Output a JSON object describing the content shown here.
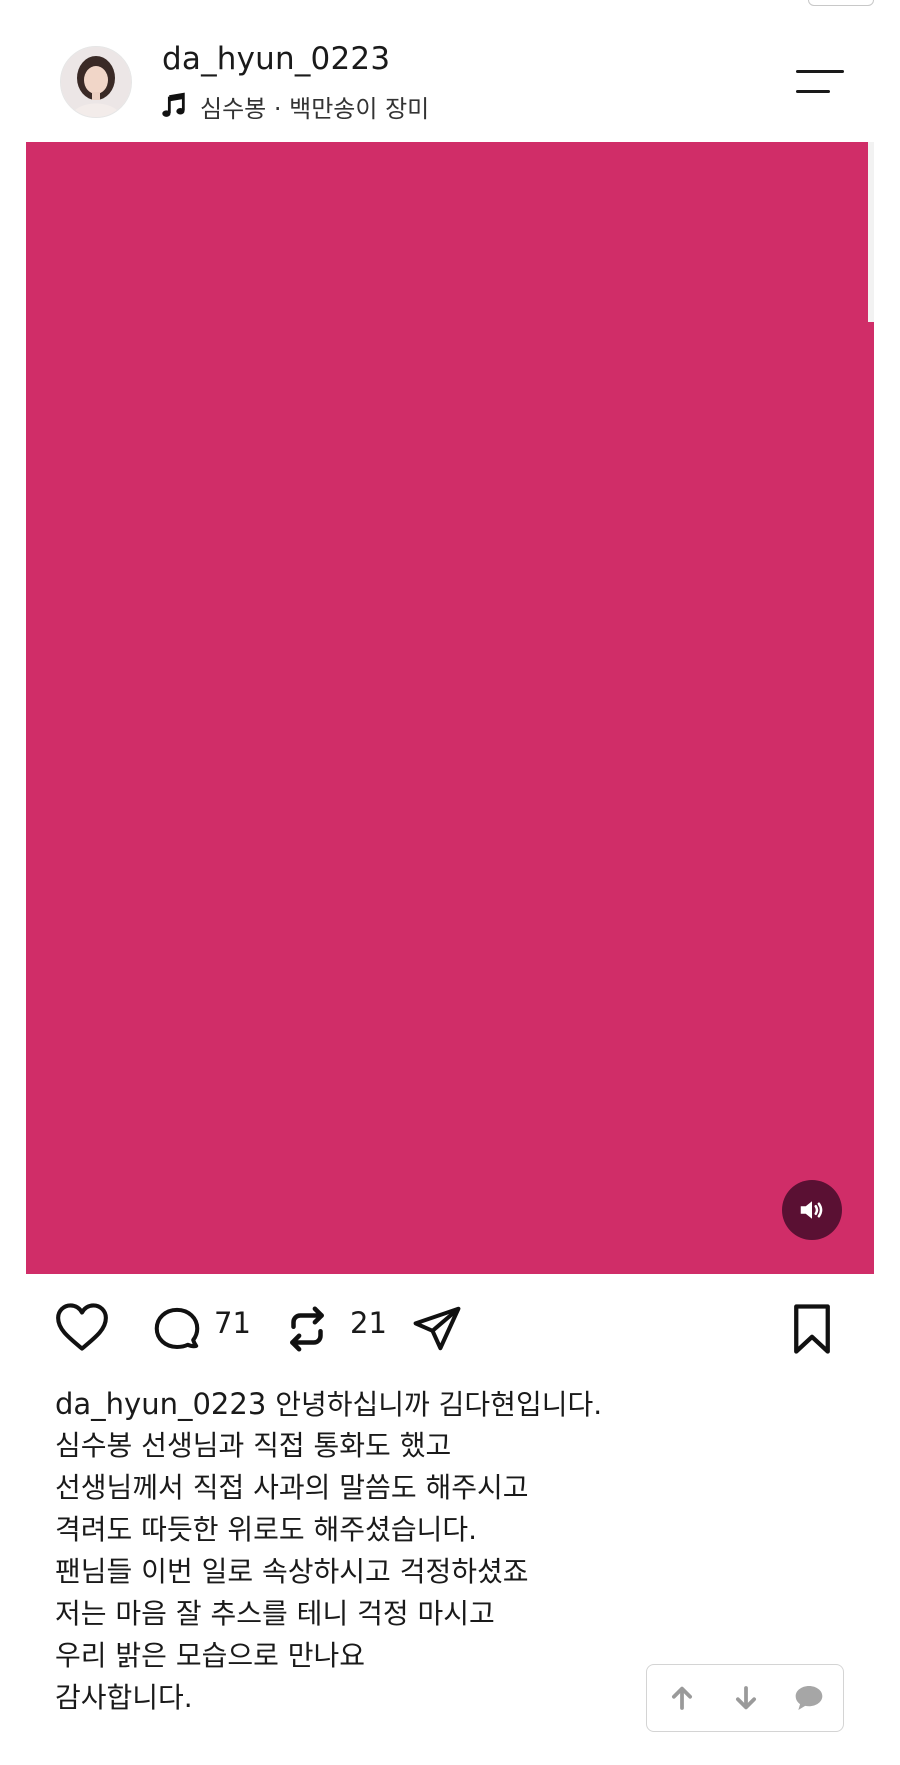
{
  "post": {
    "username": "da_hyun_0223",
    "music": "심수봉 · 백만송이 장미"
  },
  "colors": {
    "media_background": "#d02d68",
    "sound_button": "#5a1033"
  },
  "icons": {
    "header": [
      "music-note-icon",
      "menu-icon"
    ],
    "media": [
      "speaker-icon"
    ],
    "actions": [
      "heart-icon",
      "comment-icon",
      "repost-icon",
      "send-icon",
      "bookmark-icon"
    ],
    "floating": [
      "arrow-up-icon",
      "arrow-down-icon",
      "chat-bubble-icon"
    ]
  },
  "actions": {
    "comments_count": "71",
    "reposts_count": "21"
  },
  "caption": {
    "username": "da_hyun_0223",
    "lines": [
      "안녕하십니까 김다현입니다.",
      "심수봉 선생님과 직접 통화도 했고",
      "선생님께서 직접 사과의 말씀도 해주시고",
      "격려도 따듯한 위로도 해주셨습니다.",
      "팬님들 이번 일로 속상하시고 걱정하셨죠",
      "저는 마음 잘 추스를 테니 걱정 마시고",
      "우리 밝은 모습으로 만나요",
      "감사합니다."
    ]
  }
}
